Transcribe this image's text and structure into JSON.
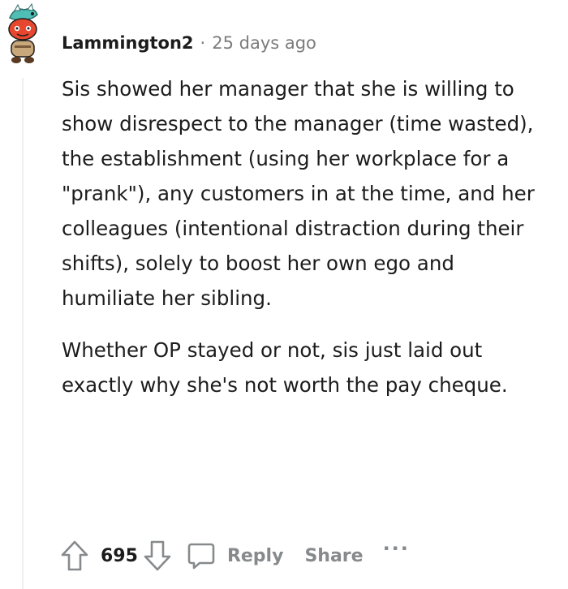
{
  "comment": {
    "username": "Lammington2",
    "separator": "·",
    "timestamp": "25 days ago",
    "paragraphs": [
      "Sis showed her manager that she is willing to show disrespect to the manager (time wasted), the establishment (using her workplace for a \"prank\"), any customers in at the time, and her colleagues (intentional distraction during their shifts), solely to boost her own ego and humiliate her sibling.",
      "Whether OP stayed or not, sis just laid out exactly why she's not worth the pay cheque."
    ]
  },
  "actions": {
    "upvote_icon": "arrow-up-icon",
    "score": "695",
    "downvote_icon": "arrow-down-icon",
    "reply_icon": "speech-bubble-icon",
    "reply_label": "Reply",
    "share_label": "Share",
    "more_label": "···"
  },
  "colors": {
    "text": "#1c1c1c",
    "muted": "#7c7c7c",
    "action_gray": "#878a8c",
    "avatar_red": "#e8472f",
    "avatar_teal": "#4fbfb5"
  }
}
